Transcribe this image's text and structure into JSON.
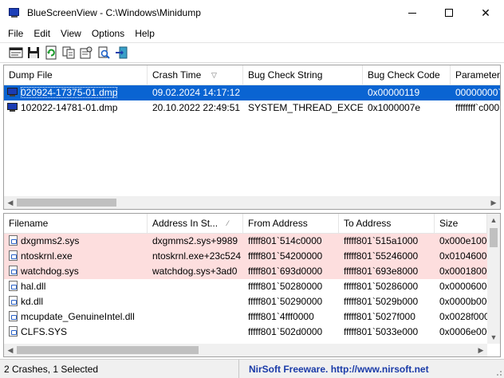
{
  "window": {
    "title": "BlueScreenView  -  C:\\Windows\\Minidump",
    "minimize_icon": "minimize-icon",
    "maximize_icon": "maximize-icon",
    "close_glyph": "✕"
  },
  "menu": [
    "File",
    "Edit",
    "View",
    "Options",
    "Help"
  ],
  "toolbar": {
    "icons": [
      "html-report-icon",
      "save-icon",
      "refresh-icon",
      "copy-icon",
      "properties-icon",
      "find-icon",
      "exit-icon"
    ]
  },
  "crash_list": {
    "columns": [
      "Dump File",
      "Crash Time",
      "Bug Check String",
      "Bug Check Code",
      "Parameter"
    ],
    "rows": [
      {
        "dump_file": "020924-17375-01.dmp",
        "crash_time": "09.02.2024 14:17:12",
        "bug_check_string": "",
        "bug_check_code": "0x00000119",
        "parameter": "00000000`0",
        "selected": true
      },
      {
        "dump_file": "102022-14781-01.dmp",
        "crash_time": "20.10.2022 22:49:51",
        "bug_check_string": "SYSTEM_THREAD_EXCE...",
        "bug_check_code": "0x1000007e",
        "parameter": "ffffffff`c000",
        "selected": false
      }
    ]
  },
  "driver_list": {
    "columns": [
      "Filename",
      "Address In St...",
      "From Address",
      "To Address",
      "Size"
    ],
    "rows": [
      {
        "filename": "dxgmms2.sys",
        "address_in_stack": "dxgmms2.sys+9989",
        "from": "fffff801`514c0000",
        "to": "fffff801`515a1000",
        "size": "0x000e1000",
        "highlight": true
      },
      {
        "filename": "ntoskrnl.exe",
        "address_in_stack": "ntoskrnl.exe+23c524",
        "from": "fffff801`54200000",
        "to": "fffff801`55246000",
        "size": "0x01046000",
        "highlight": true
      },
      {
        "filename": "watchdog.sys",
        "address_in_stack": "watchdog.sys+3ad0",
        "from": "fffff801`693d0000",
        "to": "fffff801`693e8000",
        "size": "0x00018000",
        "highlight": true
      },
      {
        "filename": "hal.dll",
        "address_in_stack": "",
        "from": "fffff801`50280000",
        "to": "fffff801`50286000",
        "size": "0x00006000",
        "highlight": false
      },
      {
        "filename": "kd.dll",
        "address_in_stack": "",
        "from": "fffff801`50290000",
        "to": "fffff801`5029b000",
        "size": "0x0000b000",
        "highlight": false
      },
      {
        "filename": "mcupdate_GenuineIntel.dll",
        "address_in_stack": "",
        "from": "fffff801`4fff0000",
        "to": "fffff801`5027f000",
        "size": "0x0028f000",
        "highlight": false
      },
      {
        "filename": "CLFS.SYS",
        "address_in_stack": "",
        "from": "fffff801`502d0000",
        "to": "fffff801`5033e000",
        "size": "0x0006e000",
        "highlight": false
      }
    ]
  },
  "status": {
    "summary": "2 Crashes, 1 Selected",
    "link": "NirSoft Freeware.  http://www.nirsoft.net"
  },
  "colors": {
    "selection": "#0a64d2",
    "highlight_row": "#fddede",
    "link": "#1a3ba8"
  }
}
